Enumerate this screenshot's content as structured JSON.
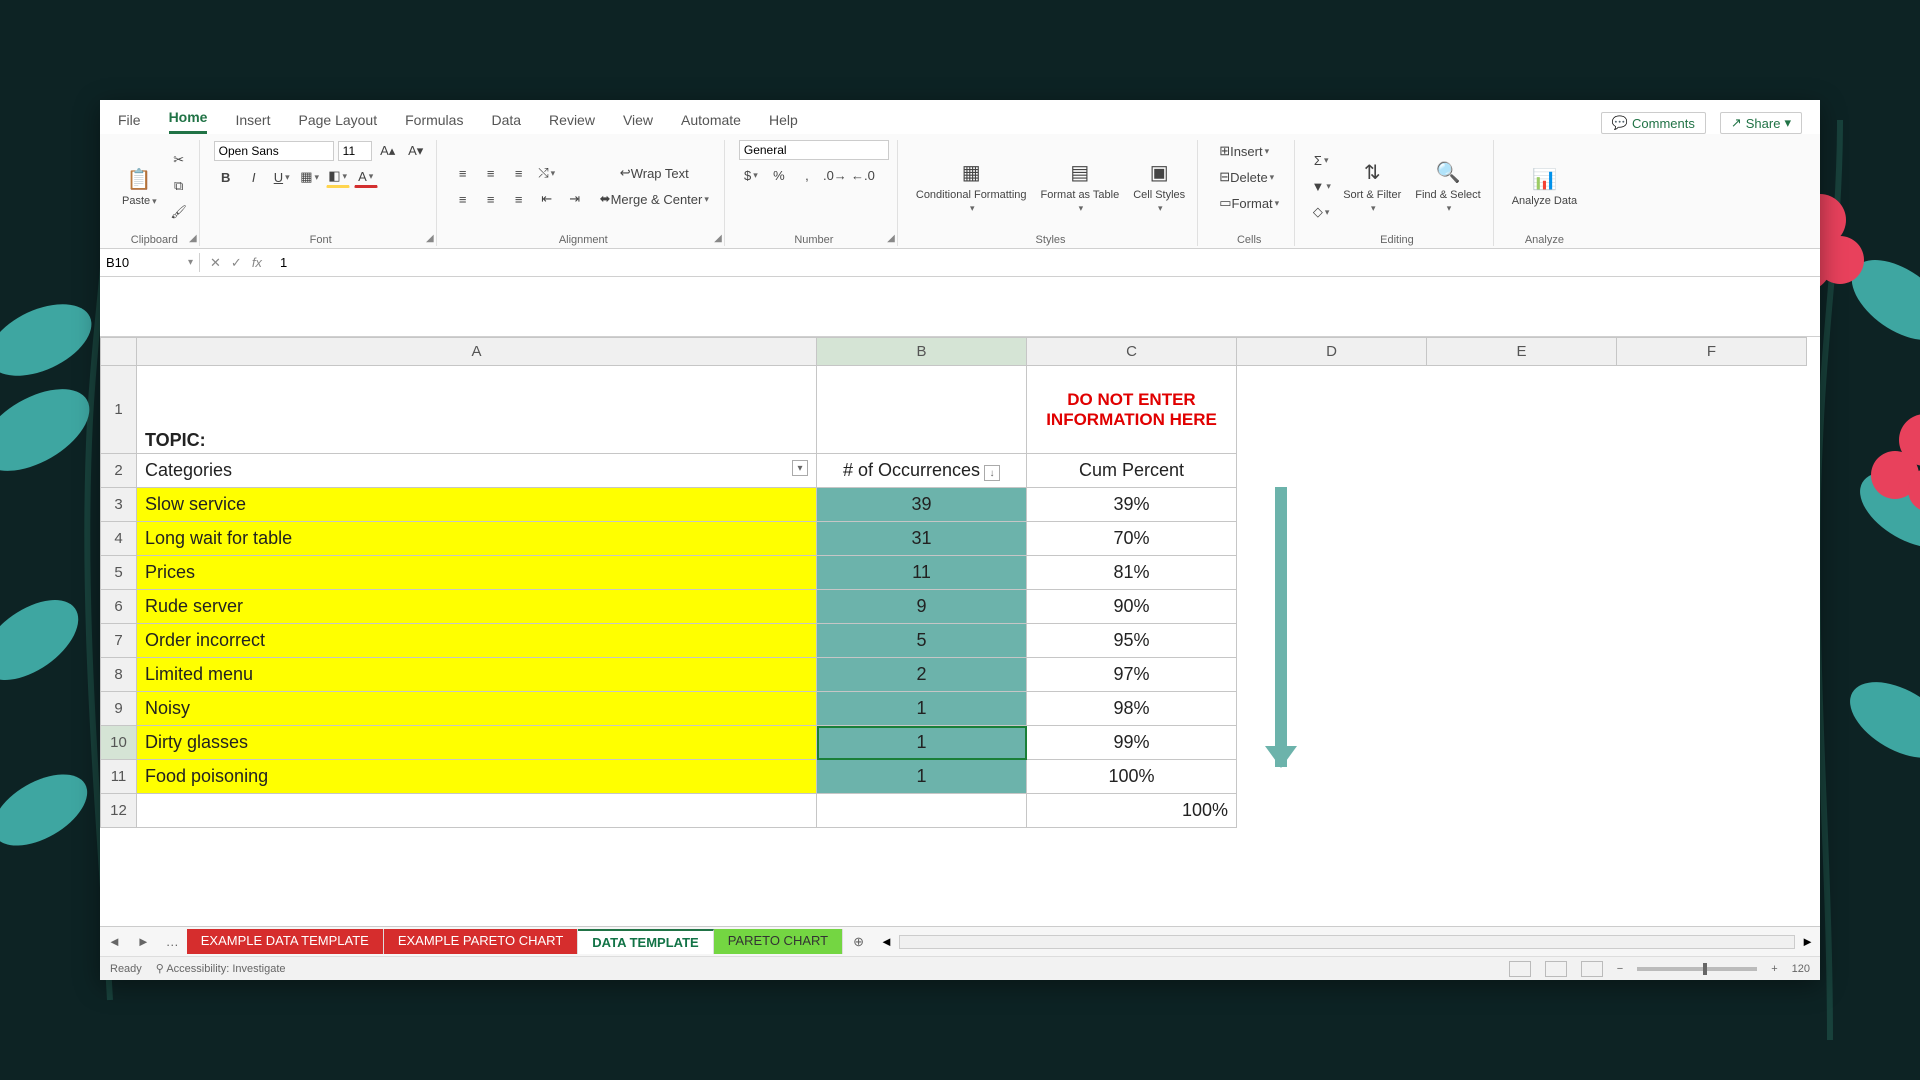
{
  "menu": {
    "tabs": [
      "File",
      "Home",
      "Insert",
      "Page Layout",
      "Formulas",
      "Data",
      "Review",
      "View",
      "Automate",
      "Help"
    ],
    "active_index": 1,
    "comments": "Comments",
    "share": "Share"
  },
  "ribbon": {
    "clipboard": {
      "paste": "Paste",
      "label": "Clipboard"
    },
    "font": {
      "name": "Open Sans",
      "size": "11",
      "label": "Font"
    },
    "alignment": {
      "wrap": "Wrap Text",
      "merge": "Merge & Center",
      "label": "Alignment"
    },
    "number": {
      "format": "General",
      "label": "Number"
    },
    "styles": {
      "cond": "Conditional Formatting",
      "table": "Format as Table",
      "cell": "Cell Styles",
      "label": "Styles"
    },
    "cells": {
      "insert": "Insert",
      "delete": "Delete",
      "format": "Format",
      "label": "Cells"
    },
    "editing": {
      "sort": "Sort & Filter",
      "find": "Find & Select",
      "label": "Editing"
    },
    "analyze": {
      "analyze": "Analyze Data",
      "label": "Analyze"
    }
  },
  "namebox": "B10",
  "formula": "1",
  "columns": [
    "A",
    "B",
    "C",
    "D",
    "E",
    "F"
  ],
  "header": {
    "topic": "TOPIC:",
    "categories": "Categories",
    "occurrences": "# of Occurrences",
    "cum": "Cum Percent",
    "warning": "DO NOT ENTER INFORMATION HERE"
  },
  "rows": [
    {
      "n": "3",
      "cat": "Slow service",
      "occ": "39",
      "pct": "39%"
    },
    {
      "n": "4",
      "cat": "Long wait for table",
      "occ": "31",
      "pct": "70%"
    },
    {
      "n": "5",
      "cat": "Prices",
      "occ": "11",
      "pct": "81%"
    },
    {
      "n": "6",
      "cat": "Rude server",
      "occ": "9",
      "pct": "90%"
    },
    {
      "n": "7",
      "cat": "Order incorrect",
      "occ": "5",
      "pct": "95%"
    },
    {
      "n": "8",
      "cat": "Limited menu",
      "occ": "2",
      "pct": "97%"
    },
    {
      "n": "9",
      "cat": "Noisy",
      "occ": "1",
      "pct": "98%"
    },
    {
      "n": "10",
      "cat": "Dirty glasses",
      "occ": "1",
      "pct": "99%"
    },
    {
      "n": "11",
      "cat": "Food poisoning",
      "occ": "1",
      "pct": "100%"
    }
  ],
  "total_row": {
    "n": "12",
    "pct": "100%"
  },
  "sheet_tabs": [
    {
      "label": "EXAMPLE DATA TEMPLATE",
      "cls": "red"
    },
    {
      "label": "EXAMPLE PARETO CHART",
      "cls": "red"
    },
    {
      "label": "DATA TEMPLATE",
      "cls": "active"
    },
    {
      "label": "PARETO CHART",
      "cls": "green"
    }
  ],
  "status": {
    "ready": "Ready",
    "acc": "Accessibility: Investigate",
    "zoom": "120"
  },
  "chart_data": {
    "type": "table",
    "title": "Pareto data template",
    "columns": [
      "Categories",
      "# of Occurrences",
      "Cum Percent"
    ],
    "categories": [
      "Slow service",
      "Long wait for table",
      "Prices",
      "Rude server",
      "Order incorrect",
      "Limited menu",
      "Noisy",
      "Dirty glasses",
      "Food poisoning"
    ],
    "values": [
      39,
      31,
      11,
      9,
      5,
      2,
      1,
      1,
      1
    ],
    "cum_percent": [
      39,
      70,
      81,
      90,
      95,
      97,
      98,
      99,
      100
    ],
    "total_percent": 100
  }
}
